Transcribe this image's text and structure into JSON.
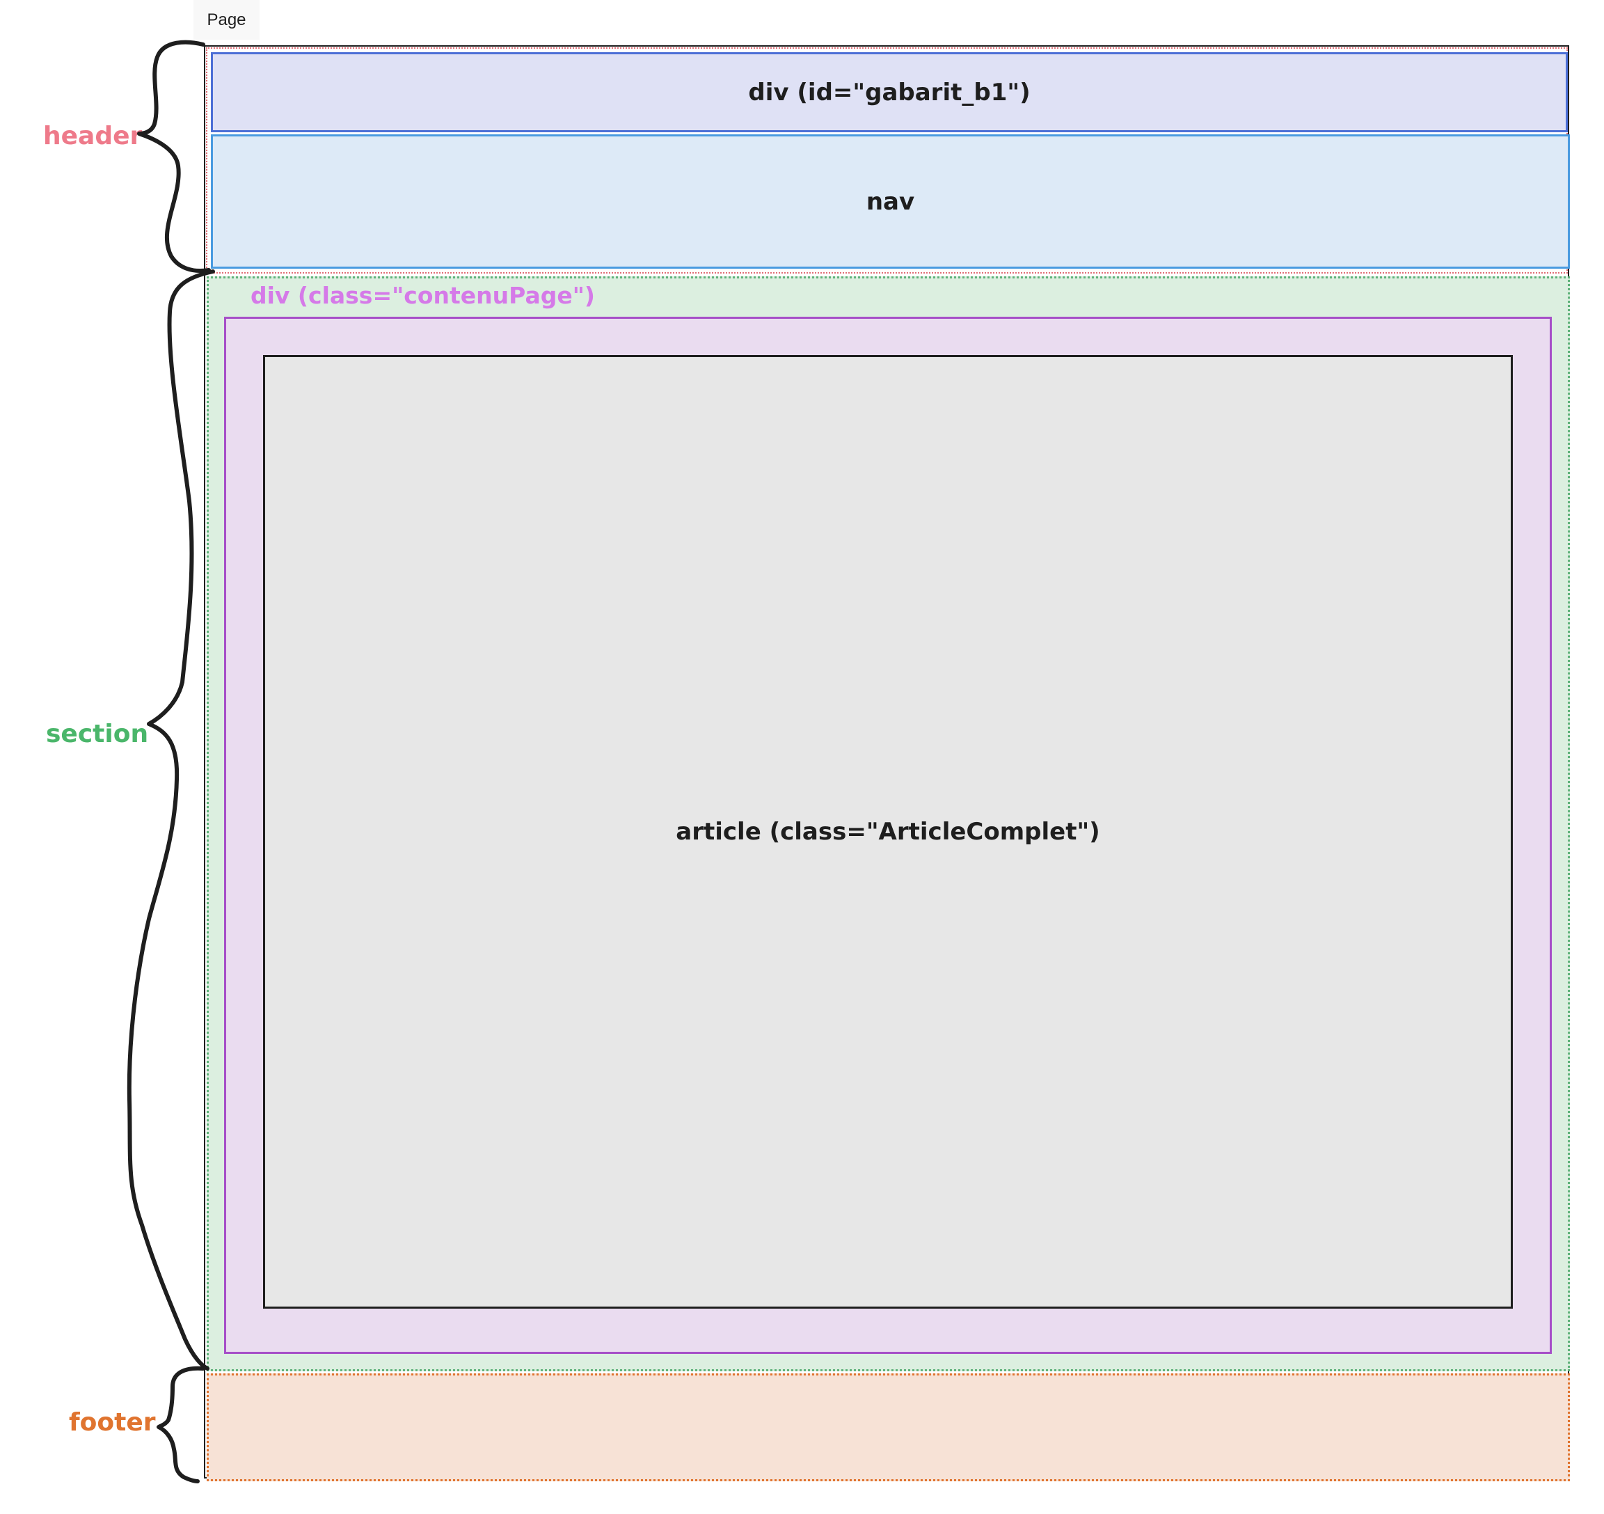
{
  "frame": {
    "name": "Page"
  },
  "blocks": {
    "header": {
      "label": "header",
      "color": "#ee7a8a"
    },
    "gabarit": {
      "label": "div (id=\"gabarit_b1\")",
      "fill": "#dfe1f5",
      "stroke": "#4c6fd6"
    },
    "nav": {
      "label": "nav",
      "fill": "#ddeaf7",
      "stroke": "#4a9be0"
    },
    "section": {
      "label": "section",
      "color": "#4ab66a",
      "fill": "#dcefe0"
    },
    "contenu_page": {
      "label": "div (class=\"contenuPage\")",
      "color": "#d57ae8",
      "fill": "#eadcf0"
    },
    "article": {
      "label": "article (class=\"ArticleComplet\")",
      "fill": "#e7e7e7"
    },
    "footer": {
      "label": "footer",
      "color": "#e0742f",
      "fill": "#f7e2d6"
    }
  }
}
